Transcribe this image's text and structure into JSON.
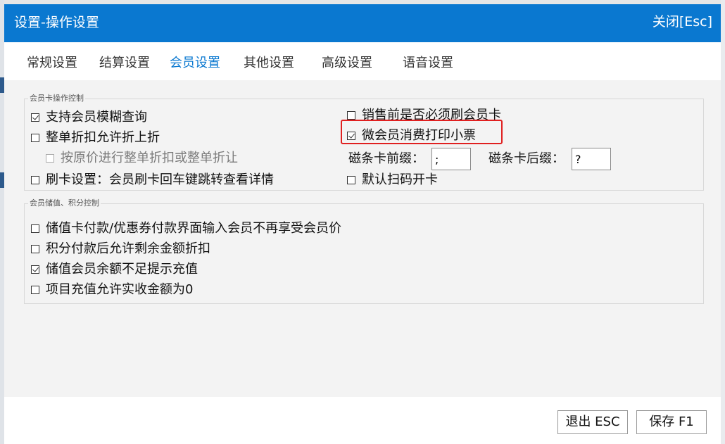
{
  "dialog": {
    "title": "设置-操作设置",
    "close_label": "关闭[Esc]"
  },
  "tabs": [
    {
      "label": "常规设置",
      "active": false
    },
    {
      "label": "结算设置",
      "active": false
    },
    {
      "label": "会员设置",
      "active": true
    },
    {
      "label": "其他设置",
      "active": false
    },
    {
      "label": "高级设置",
      "active": false
    },
    {
      "label": "语音设置",
      "active": false
    }
  ],
  "card_group": {
    "title": "会员卡操作控制",
    "left_options": [
      {
        "label": "支持会员模糊查询",
        "checked": true
      },
      {
        "label": "整单折扣允许折上折",
        "checked": false
      },
      {
        "label": "按原价进行整单折扣或整单折让",
        "checked": false,
        "disabled": true
      },
      {
        "label": "刷卡设置：会员刷卡回车键跳转查看详情",
        "checked": false
      }
    ],
    "right_options": [
      {
        "label": "销售前是否必须刷会员卡",
        "checked": false
      },
      {
        "label": "微会员消费打印小票",
        "checked": true
      },
      {
        "label": "默认扫码开卡",
        "checked": false
      }
    ],
    "prefix_label": "磁条卡前缀：",
    "prefix_value": ";",
    "suffix_label": "磁条卡后缀：",
    "suffix_value": "?"
  },
  "value_group": {
    "title": "会员储值、积分控制",
    "options": [
      {
        "label": "储值卡付款/优惠券付款界面输入会员不再享受会员价",
        "checked": false
      },
      {
        "label": "积分付款后允许剩余金额折扣",
        "checked": false
      },
      {
        "label": "储值会员余额不足提示充值",
        "checked": true
      },
      {
        "label": "项目充值允许实收金额为0",
        "checked": false
      }
    ]
  },
  "footer": {
    "exit_label": "退出 ESC",
    "save_label": "保存 F1"
  },
  "colors": {
    "titlebar": "#0a78d0",
    "active_tab": "#0a78d0",
    "highlight": "#e02020"
  }
}
